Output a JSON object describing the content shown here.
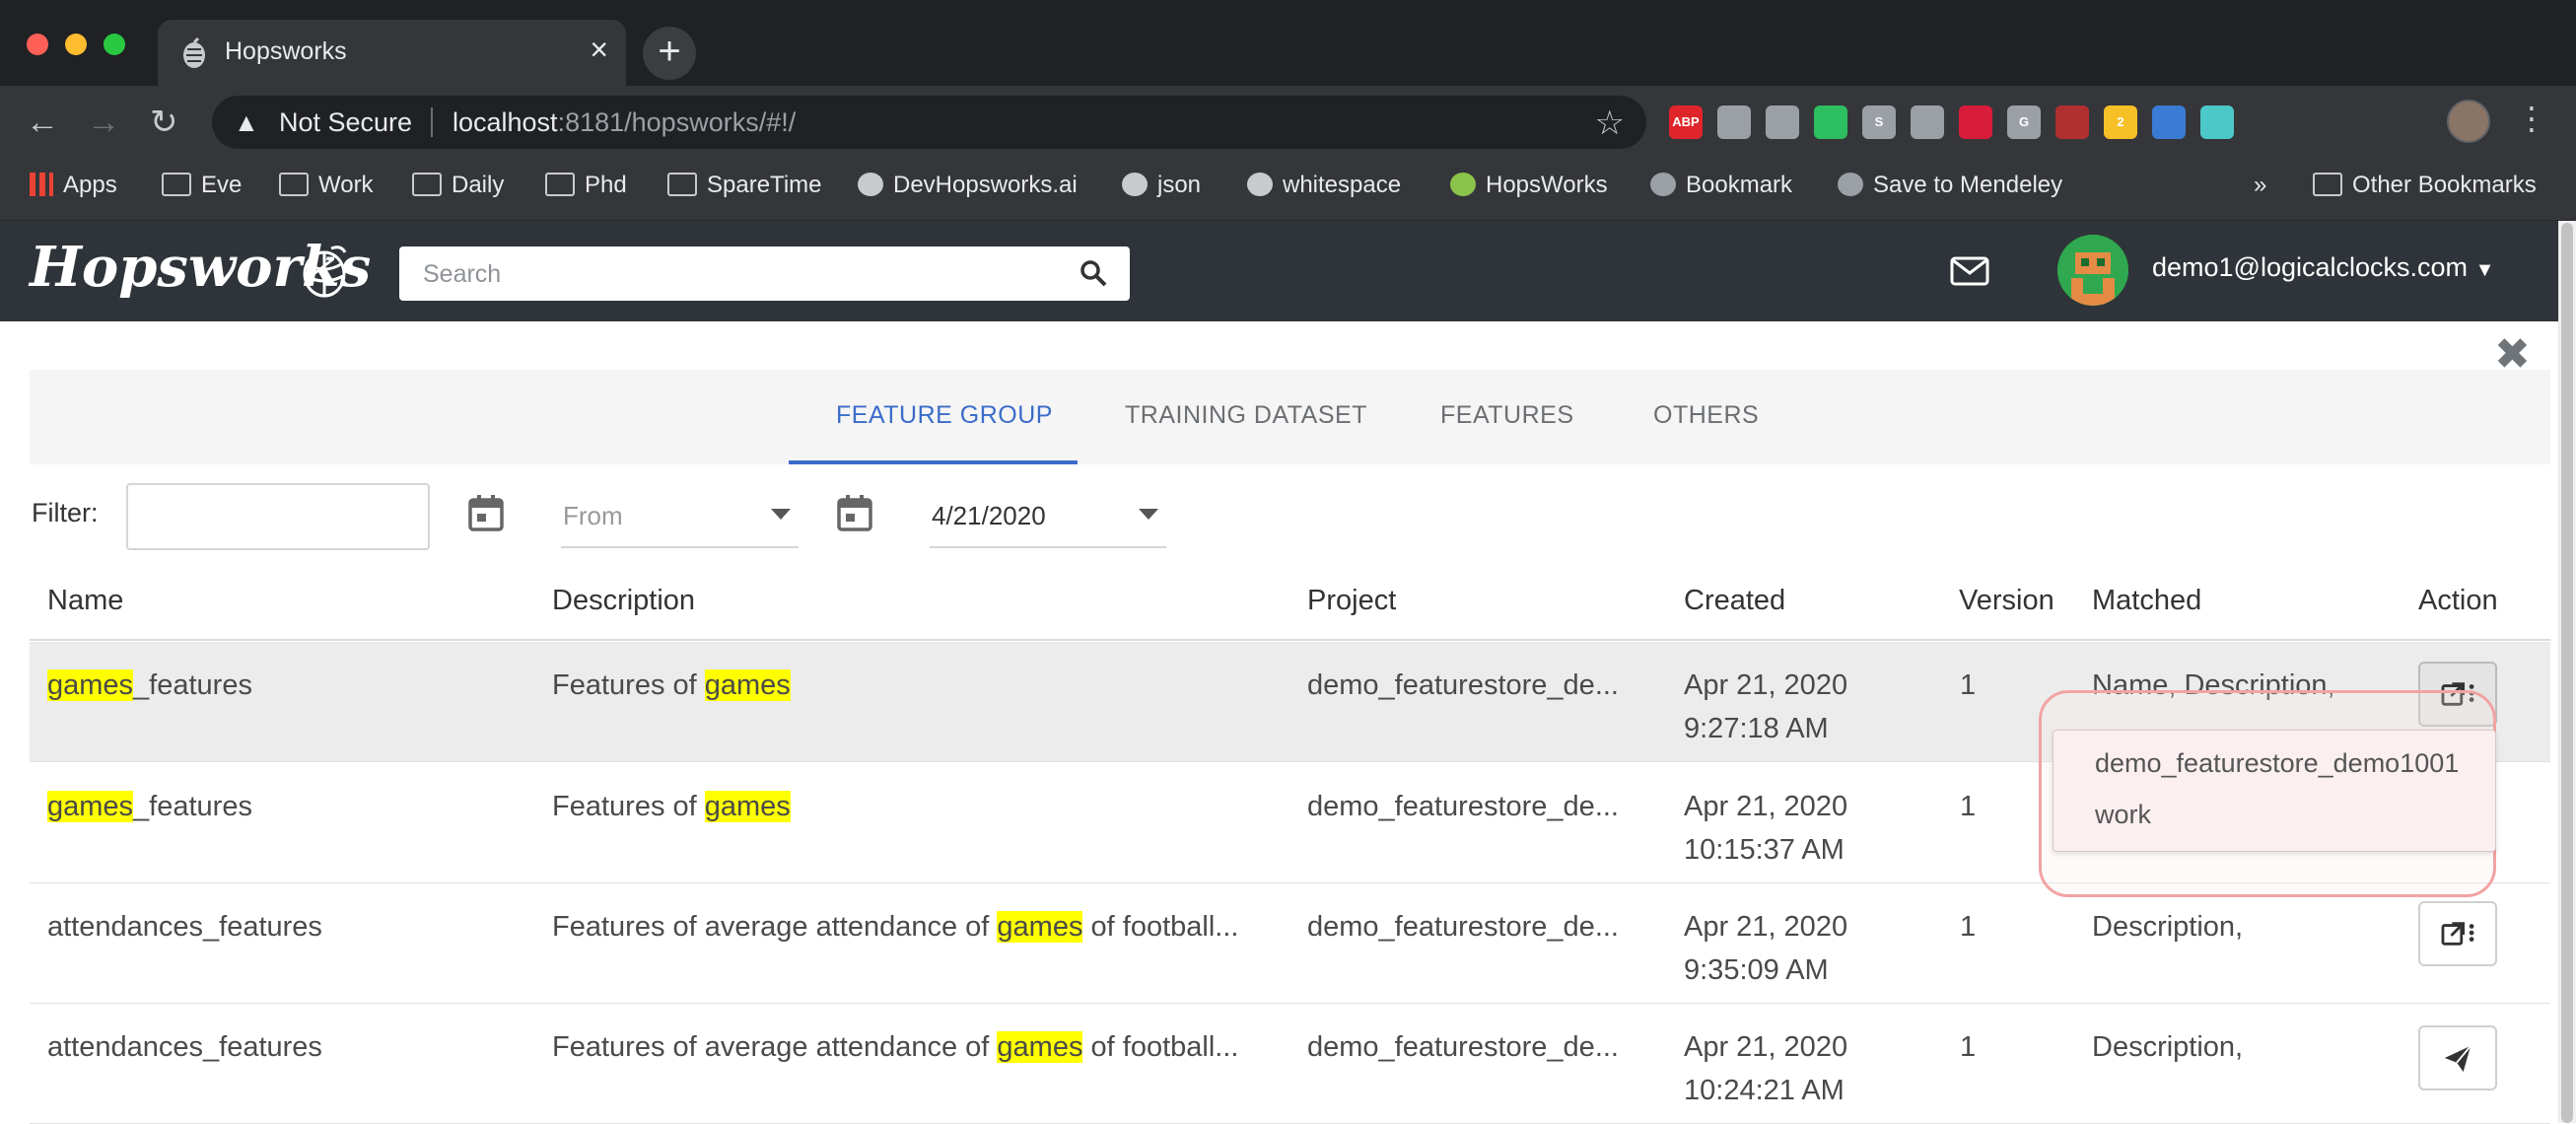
{
  "browser": {
    "tab_title": "Hopsworks",
    "security_label": "Not Secure",
    "url_host": "localhost",
    "url_rest": ":8181/hopsworks/#!/",
    "extensions": [
      {
        "name": "adblock",
        "label": "ABP",
        "color": "#e0252a"
      },
      {
        "name": "briefcase",
        "label": "",
        "color": "#9aa0a6"
      },
      {
        "name": "dropbox",
        "label": "",
        "color": "#9aa0a6"
      },
      {
        "name": "evernote",
        "label": "",
        "color": "#2dbe60"
      },
      {
        "name": "skype",
        "label": "S",
        "color": "#9aa0a6"
      },
      {
        "name": "lightbulb",
        "label": "",
        "color": "#9aa0a6"
      },
      {
        "name": "mendeley",
        "label": "",
        "color": "#d71d3b"
      },
      {
        "name": "grammarly",
        "label": "G",
        "color": "#9aa0a6"
      },
      {
        "name": "toolbox",
        "label": "",
        "color": "#b03030"
      },
      {
        "name": "notes",
        "label": "2",
        "color": "#f6c026"
      },
      {
        "name": "shield",
        "label": "",
        "color": "#3a7bd5"
      },
      {
        "name": "react",
        "label": "",
        "color": "#4dc8c8"
      }
    ],
    "bookmarks": [
      {
        "label": "Apps",
        "icon": "apps-grid-icon"
      },
      {
        "label": "Eve",
        "icon": "folder-icon"
      },
      {
        "label": "Work",
        "icon": "folder-icon"
      },
      {
        "label": "Daily",
        "icon": "folder-icon"
      },
      {
        "label": "Phd",
        "icon": "folder-icon"
      },
      {
        "label": "SpareTime",
        "icon": "folder-icon"
      },
      {
        "label": "DevHopsworks.ai",
        "icon": "hops-icon"
      },
      {
        "label": "json",
        "icon": "braces-icon"
      },
      {
        "label": "whitespace",
        "icon": "ufo-icon"
      },
      {
        "label": "HopsWorks",
        "icon": "hops-green-icon"
      },
      {
        "label": "Bookmark",
        "icon": "globe-icon"
      },
      {
        "label": "Save to Mendeley",
        "icon": "globe-icon"
      }
    ],
    "bookmarks_overflow": "»",
    "other_bookmarks": "Other Bookmarks"
  },
  "app": {
    "logo_text": "Hopsworks",
    "search_placeholder": "Search",
    "user_email": "demo1@logicalclocks.com"
  },
  "tabs": [
    {
      "label": "FEATURE GROUP",
      "active": true
    },
    {
      "label": "TRAINING DATASET",
      "active": false
    },
    {
      "label": "FEATURES",
      "active": false
    },
    {
      "label": "OTHERS",
      "active": false
    }
  ],
  "filter": {
    "label": "Filter:",
    "value": "",
    "from_placeholder": "From",
    "to_value": "4/21/2020"
  },
  "table": {
    "columns": [
      "Name",
      "Description",
      "Project",
      "Created",
      "Version",
      "Matched",
      "Action"
    ],
    "rows": [
      {
        "name_hl": "games",
        "name_rest": "_features",
        "desc_pre": "Features of ",
        "desc_hl": "games",
        "desc_post": "",
        "project": "demo_featurestore_de...",
        "created_date": "Apr 21, 2020",
        "created_time": "9:27:18 AM",
        "version": "1",
        "matched": "Name, Description,"
      },
      {
        "name_hl": "games",
        "name_rest": "_features",
        "desc_pre": "Features of ",
        "desc_hl": "games",
        "desc_post": "",
        "project": "demo_featurestore_de...",
        "created_date": "Apr 21, 2020",
        "created_time": "10:15:37 AM",
        "version": "1",
        "matched": ""
      },
      {
        "name_hl": "",
        "name_rest": "attendances_features",
        "desc_pre": "Features of average attendance of ",
        "desc_hl": "games",
        "desc_post": " of football...",
        "project": "demo_featurestore_de...",
        "created_date": "Apr 21, 2020",
        "created_time": "9:35:09 AM",
        "version": "1",
        "matched": "Description,"
      },
      {
        "name_hl": "",
        "name_rest": "attendances_features",
        "desc_pre": "Features of average attendance of ",
        "desc_hl": "games",
        "desc_post": " of football...",
        "project": "demo_featurestore_de...",
        "created_date": "Apr 21, 2020",
        "created_time": "10:24:21 AM",
        "version": "1",
        "matched": "Description,"
      }
    ]
  },
  "popover": {
    "items": [
      "demo_featurestore_demo1001",
      "work"
    ]
  },
  "colors": {
    "accent": "#3b6cc9",
    "highlight": "#ffff00",
    "navbar": "#2e3439"
  }
}
